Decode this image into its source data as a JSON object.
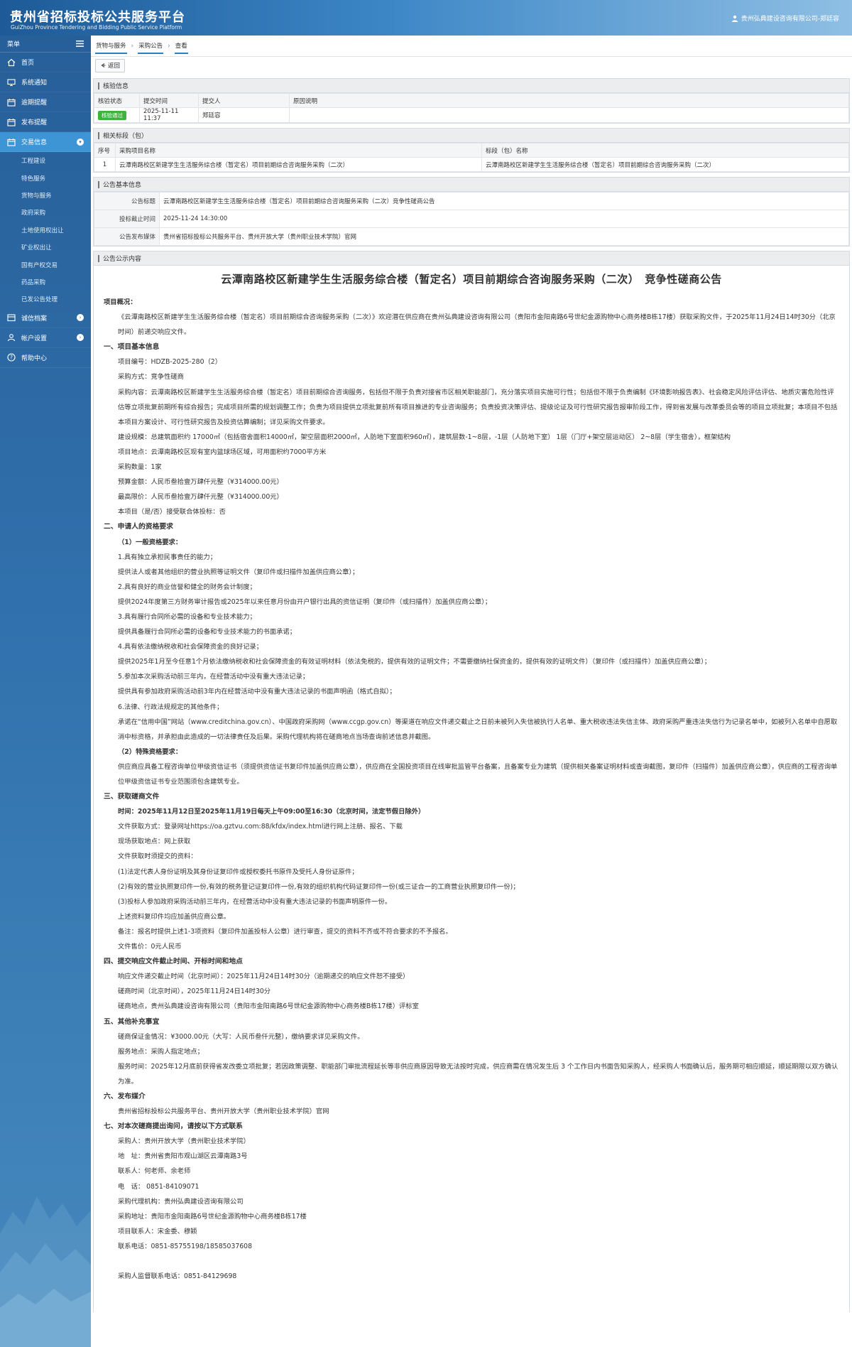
{
  "header": {
    "title_cn": "贵州省招标投标公共服务平台",
    "title_en": "GuiZhou Province Tendering and Bidding Public Service Platform",
    "user": "贵州弘典建设咨询有限公司-郑廷容"
  },
  "sidebar": {
    "menu_label": "菜单",
    "items": [
      {
        "label": "首页",
        "icon": "home-icon"
      },
      {
        "label": "系统通知",
        "icon": "monitor-icon"
      },
      {
        "label": "逾期提醒",
        "icon": "calendar-icon"
      },
      {
        "label": "发布提醒",
        "icon": "calendar-icon"
      },
      {
        "label": "交易信息",
        "icon": "calendar-icon"
      },
      {
        "label": "诚信档案",
        "icon": "archive-icon"
      },
      {
        "label": "帐户设置",
        "icon": "user-icon"
      },
      {
        "label": "帮助中心",
        "icon": "help-icon"
      }
    ],
    "sub_items": [
      "工程建设",
      "特色服务",
      "货物与服务",
      "政府采购",
      "土地使用权出让",
      "矿业权出让",
      "国有产权交易",
      "药品采购",
      "已发公告处理"
    ]
  },
  "breadcrumb": [
    "货物与服务",
    "采购公告",
    "查看"
  ],
  "back_button": "返回",
  "verify": {
    "title": "核验信息",
    "headers": [
      "核验状态",
      "提交时间",
      "提交人",
      "原因说明"
    ],
    "status": "核验通过",
    "time": "2025-11-11 11:37",
    "submitter": "郑廷容",
    "reason": ""
  },
  "lots": {
    "title": "相关标段（包）",
    "headers": [
      "序号",
      "采购项目名称",
      "标段（包）名称"
    ],
    "rows": [
      {
        "no": "1",
        "project": "云潭南路校区新建学生生活服务综合楼（暂定名）项目前期综合咨询服务采购（二次）",
        "lot": "云潭南路校区新建学生生活服务综合楼（暂定名）项目前期综合咨询服务采购（二次）"
      }
    ]
  },
  "basic": {
    "title": "公告基本信息",
    "rows": [
      {
        "label": "公告标题",
        "value": "云潭南路校区新建学生生活服务综合楼（暂定名）项目前期综合咨询服务采购（二次）竞争性磋商公告"
      },
      {
        "label": "投标截止时间",
        "value": "2025-11-24 14:30:00"
      },
      {
        "label": "公告发布媒体",
        "value": "贵州省招标投标公共服务平台、贵州开放大学（贵州职业技术学院）官网"
      }
    ]
  },
  "notice": {
    "section_title": "公告公示内容",
    "title": "云潭南路校区新建学生生活服务综合楼（暂定名）项目前期综合咨询服务采购（二次）　竞争性磋商公告",
    "lines": [
      {
        "t": "项目概况：",
        "c": "b"
      },
      {
        "t": "《云潭南路校区新建学生生活服务综合楼（暂定名）项目前期综合咨询服务采购（二次）》欢迎潜在供应商在贵州弘典建设咨询有限公司（贵阳市金阳南路6号世纪金源购物中心商务楼B栋17楼）获取采购文件，于2025年11月24日14时30分（北京时间）前递交响应文件。",
        "c": "i1"
      },
      {
        "t": "一、项目基本信息",
        "c": "h"
      },
      {
        "t": "项目编号：HDZB-2025-280（2）",
        "c": "i1"
      },
      {
        "t": "采购方式：竞争性磋商",
        "c": "i1"
      },
      {
        "t": "采购内容：云潭南路校区新建学生生活服务综合楼（暂定名）项目前期综合咨询服务，包括但不限于负责对接省市区相关职能部门，充分落实项目实施可行性；包括但不限于负责编制《环境影响报告表》、社会稳定风险评估评估、地质灾害危险性评估等立项批复前期所有综合报告；完成项目所需的规划调整工作；负责为项目提供立项批复前所有项目推进的专业咨询服务；负责投资决策评估、提级论证及可行性研究报告报审阶段工作，得到省发展与改革委员会等的项目立项批复；本项目不包括本项目方案设计、可行性研究报告及投资估算编制；详见采购文件要求。",
        "c": "i1"
      },
      {
        "t": "建设规模：总建筑面积约 17000㎡（包括宿舍面积14000㎡，架空层面积2000㎡，人防地下室面积960㎡），建筑层数-1~8层，-1层（人防地下室） 1层（门厅+架空层运动区） 2~8层（学生宿舍），框架结构",
        "c": "i1"
      },
      {
        "t": "项目地点：云潭南路校区现有室内篮球场区域，可用面积约7000平方米",
        "c": "i1"
      },
      {
        "t": "采购数量：1家",
        "c": "i1"
      },
      {
        "t": "预算金额：人民币叁拾壹万肆仟元整（¥314000.00元）",
        "c": "i1"
      },
      {
        "t": "最高限价：人民币叁拾壹万肆仟元整（¥314000.00元）",
        "c": "i1"
      },
      {
        "t": "本项目（是/否）接受联合体投标：否",
        "c": "i1"
      },
      {
        "t": "二、申请人的资格要求",
        "c": "h"
      },
      {
        "t": "（1）一般资格要求：",
        "c": "i1 b"
      },
      {
        "t": "1.具有独立承担民事责任的能力；",
        "c": "i1"
      },
      {
        "t": "提供法人或者其他组织的营业执照等证明文件（复印件或扫描件加盖供应商公章）；",
        "c": "i1"
      },
      {
        "t": "2.具有良好的商业信誉和健全的财务会计制度；",
        "c": "i1"
      },
      {
        "t": "提供2024年度第三方财务审计报告或2025年以来任意月份由开户银行出具的资信证明（复印件（或扫描件）加盖供应商公章）；",
        "c": "i1"
      },
      {
        "t": "3.具有履行合同所必需的设备和专业技术能力；",
        "c": "i1"
      },
      {
        "t": "提供具备履行合同所必需的设备和专业技术能力的书面承诺；",
        "c": "i1"
      },
      {
        "t": "4.具有依法缴纳税收和社会保障资金的良好记录；",
        "c": "i1"
      },
      {
        "t": "提供2025年1月至今任意1个月依法缴纳税收和社会保障资金的有效证明材料（依法免税的，提供有效的证明文件；不需要缴纳社保资金的，提供有效的证明文件）（复印件（或扫描件）加盖供应商公章）；",
        "c": "i1"
      },
      {
        "t": "5.参加本次采购活动前三年内，在经营活动中没有重大违法记录；",
        "c": "i1"
      },
      {
        "t": "提供具有参加政府采购活动前3年内在经营活动中没有重大违法记录的书面声明函（格式自拟）；",
        "c": "i1"
      },
      {
        "t": "6.法律、行政法规规定的其他条件；",
        "c": "i1"
      },
      {
        "t": "承诺在“信用中国”网站（www.creditchina.gov.cn）、中国政府采购网（www.ccgp.gov.cn）等渠道在响应文件递交截止之日前未被列入失信被执行人名单、重大税收违法失信主体、政府采购严重违法失信行为记录名单中，如被列入名单中自愿取消中标资格，并承担由此造成的一切法律责任及后果。采购代理机构将在磋商地点当场查询前述信息并截图。",
        "c": "i1"
      },
      {
        "t": "（2）特殊资格要求：",
        "c": "i1 b"
      },
      {
        "t": "供应商应具备工程咨询单位甲级资信证书（须提供资信证书复印件加盖供应商公章），供应商在全国投资项目在线审批监管平台备案，且备案专业为建筑（提供相关备案证明材料或查询截图，复印件（扫描件）加盖供应商公章），供应商的工程咨询单位甲级资信证书专业范围须包含建筑专业。",
        "c": "i1"
      },
      {
        "t": "三、获取磋商文件",
        "c": "h"
      },
      {
        "t": "时间：2025年11月12日至2025年11月19日每天上午09:00至16:30（北京时间，法定节假日除外）",
        "c": "i1 b"
      },
      {
        "t": "文件获取方式：登录网址https://oa.gztvu.com:88/kfdx/index.html进行网上注册、报名、下载",
        "c": "i1"
      },
      {
        "t": "现场获取地点：网上获取",
        "c": "i1"
      },
      {
        "t": "文件获取时须提交的资料：",
        "c": "i1"
      },
      {
        "t": "(1)法定代表人身份证明及其身份证复印件或授权委托书原件及受托人身份证原件；",
        "c": "i1"
      },
      {
        "t": "(2)有效的营业执照复印件一份,有效的税务登记证复印件一份,有效的组织机构代码证复印件一份(或三证合一的工商营业执照复印件一份)；",
        "c": "i1"
      },
      {
        "t": "(3)投标人参加政府采购活动前三年内，在经营活动中没有重大违法记录的书面声明原件一份。",
        "c": "i1"
      },
      {
        "t": "上述资料复印件均应加盖供应商公章。",
        "c": "i1"
      },
      {
        "t": "备注：报名时提供上述1-3项资料（复印件加盖投标人公章）进行审查，提交的资料不齐或不符合要求的不予报名。",
        "c": "i1"
      },
      {
        "t": "文件售价：0元人民币",
        "c": "i1"
      },
      {
        "t": "四、提交响应文件截止时间、开标时间和地点",
        "c": "h"
      },
      {
        "t": "响应文件递交截止时间（北京时间）：2025年11月24日14时30分（逾期递交的响应文件恕不接受）",
        "c": "i1"
      },
      {
        "t": "磋商时间（北京时间），2025年11月24日14时30分",
        "c": "i1"
      },
      {
        "t": "磋商地点，贵州弘典建设咨询有限公司（贵阳市金阳南路6号世纪金源购物中心商务楼B栋17楼）评标室",
        "c": "i1"
      },
      {
        "t": "五、其他补充事宜",
        "c": "h"
      },
      {
        "t": "磋商保证金情况：¥3000.00元（大写：人民币叁仟元整），缴纳要求详见采购文件。",
        "c": "i1"
      },
      {
        "t": "服务地点：采购人指定地点；",
        "c": "i1"
      },
      {
        "t": "服务时间：2025年12月底前获得省发改委立项批复；若因政策调整、职能部门审批流程延长等非供应商原因导致无法按时完成，供应商需在情况发生后 3 个工作日内书面告知采购人，经采购人书面确认后，服务期可相应顺延，顺延期限以双方确认为准。",
        "c": "i1"
      },
      {
        "t": "六、发布媒介",
        "c": "h"
      },
      {
        "t": "贵州省招标投标公共服务平台、贵州开放大学（贵州职业技术学院）官网",
        "c": "i1"
      },
      {
        "t": "七、对本次磋商提出询问，请按以下方式联系",
        "c": "h"
      },
      {
        "t": "采购人：贵州开放大学（贵州职业技术学院）",
        "c": "i1"
      },
      {
        "t": "地　址：贵州省贵阳市观山湖区云潭南路3号",
        "c": "i1"
      },
      {
        "t": "联系人：何老师、余老师",
        "c": "i1"
      },
      {
        "t": "电　话： 0851-84109071",
        "c": "i1"
      },
      {
        "t": "采购代理机构：贵州弘典建设咨询有限公司",
        "c": "i1"
      },
      {
        "t": "采购地址：贵阳市金阳南路6号世纪金源购物中心商务楼B栋17楼",
        "c": "i1"
      },
      {
        "t": "项目联系人：宋金委、穆颖",
        "c": "i1"
      },
      {
        "t": "联系电话：0851-85755198/18585037608",
        "c": "i1"
      },
      {
        "t": "采购人监督联系电话：0851-84129698",
        "c": "i1 gap"
      }
    ]
  }
}
